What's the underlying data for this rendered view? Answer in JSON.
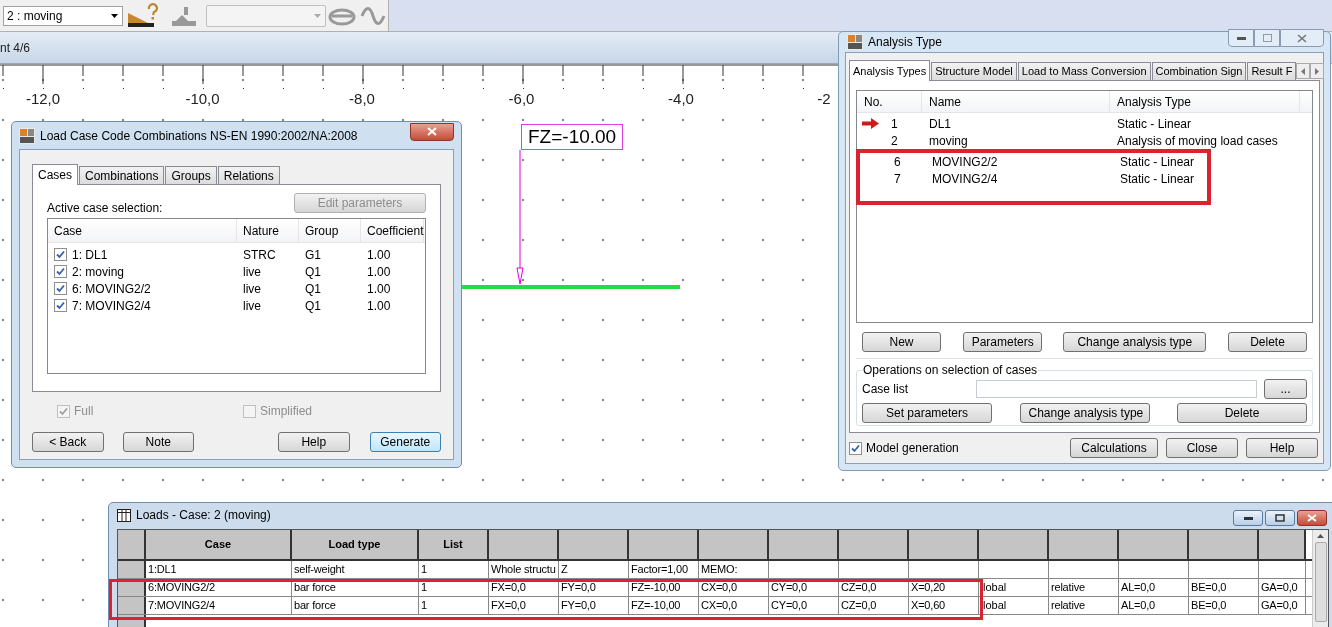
{
  "toolbar": {
    "case_combo": "2 : moving"
  },
  "view": {
    "title": "nt 4/6",
    "ruler_labels": [
      "-12,0",
      "-10,0",
      "-8,0",
      "-6,0",
      "-4,0",
      "-2"
    ],
    "load_label": "FZ=-10.00"
  },
  "load_case_dialog": {
    "title": "Load Case Code Combinations NS-EN 1990:2002/NA:2008",
    "tabs": [
      {
        "label": "Cases",
        "selected": true
      },
      {
        "label": "Combinations",
        "selected": false
      },
      {
        "label": "Groups",
        "selected": false
      },
      {
        "label": "Relations",
        "selected": false
      }
    ],
    "selection_label": "Active case selection:",
    "edit_button": {
      "label": "Edit parameters",
      "disabled": true
    },
    "columns": [
      "Case",
      "Nature",
      "Group",
      "Coefficient"
    ],
    "rows": [
      {
        "case": "1: DL1",
        "nature": "STRC",
        "group": "G1",
        "coefficient": "1.00",
        "checked": true
      },
      {
        "case": "2: moving",
        "nature": "live",
        "group": "Q1",
        "coefficient": "1.00",
        "checked": true
      },
      {
        "case": "6: MOVING2/2",
        "nature": "live",
        "group": "Q1",
        "coefficient": "1.00",
        "checked": true
      },
      {
        "case": "7: MOVING2/4",
        "nature": "live",
        "group": "Q1",
        "coefficient": "1.00",
        "checked": true
      }
    ],
    "options": [
      {
        "label": "Full",
        "checked": true,
        "disabled": true
      },
      {
        "label": "Simplified",
        "checked": false,
        "disabled": true
      }
    ],
    "buttons": [
      {
        "label": "< Back",
        "default": false
      },
      {
        "label": "Note",
        "default": false
      },
      {
        "label": "Help",
        "default": false
      },
      {
        "label": "Generate",
        "default": true
      }
    ]
  },
  "analysis_dialog": {
    "title": "Analysis Type",
    "tabs": [
      {
        "label": "Analysis Types",
        "selected": true
      },
      {
        "label": "Structure Model",
        "selected": false
      },
      {
        "label": "Load to Mass Conversion",
        "selected": false
      },
      {
        "label": "Combination Sign",
        "selected": false
      },
      {
        "label": "Result F",
        "selected": false
      }
    ],
    "columns": [
      "No.",
      "Name",
      "Analysis Type"
    ],
    "rows": [
      {
        "no": "1",
        "name": "DL1",
        "type": "Static - Linear",
        "current": true,
        "highlighted": false
      },
      {
        "no": "2",
        "name": "moving",
        "type": "Analysis of moving load cases",
        "current": false,
        "highlighted": false
      },
      {
        "no": "6",
        "name": "MOVING2/2",
        "type": "Static - Linear",
        "current": false,
        "highlighted": true
      },
      {
        "no": "7",
        "name": "MOVING2/4",
        "type": "Static - Linear",
        "current": false,
        "highlighted": true
      }
    ],
    "buttons": [
      "New",
      "Parameters",
      "Change analysis type",
      "Delete"
    ],
    "operations": {
      "legend": "Operations on selection of cases",
      "case_list_label": "Case list",
      "browse_button": "...",
      "buttons": [
        "Set parameters",
        "Change analysis type",
        "Delete"
      ]
    },
    "model_generation": {
      "label": "Model generation",
      "checked": true
    },
    "footer_buttons": [
      "Calculations",
      "Close",
      "Help"
    ]
  },
  "loads_window": {
    "title": "Loads - Case: 2 (moving)",
    "columns": [
      "Case",
      "Load type",
      "List"
    ],
    "rows": [
      {
        "highlighted": false,
        "cells": [
          "1:DL1",
          "self-weight",
          "1",
          "Whole structu",
          "Z",
          "Factor=1,00",
          "MEMO:"
        ]
      },
      {
        "highlighted": true,
        "cells": [
          "6:MOVING2/2",
          "bar force",
          "1",
          "FX=0,0",
          "FY=0,0",
          "FZ=-10,00",
          "CX=0,0",
          "CY=0,0",
          "CZ=0,0",
          "X=0,20",
          "lobal",
          "relative",
          "AL=0,0",
          "BE=0,0",
          "GA=0,0"
        ]
      },
      {
        "highlighted": true,
        "cells": [
          "7:MOVING2/4",
          "bar force",
          "1",
          "FX=0,0",
          "FY=0,0",
          "FZ=-10,00",
          "CX=0,0",
          "CY=0,0",
          "CZ=0,0",
          "X=0,60",
          "lobal",
          "relative",
          "AL=0,0",
          "BE=0,0",
          "GA=0,0"
        ]
      }
    ]
  }
}
